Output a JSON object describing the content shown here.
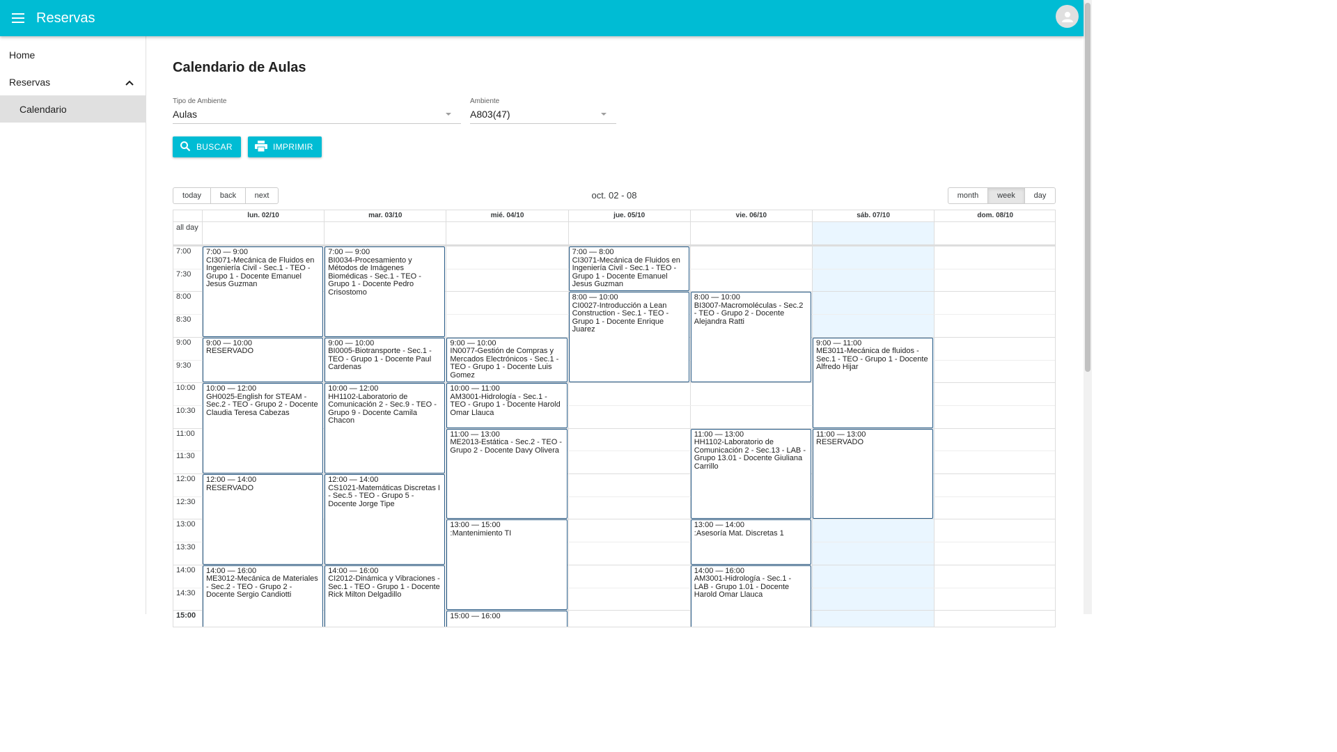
{
  "appbar": {
    "title": "Reservas",
    "menu_icon": "menu-icon",
    "avatar_icon": "account-circle-icon"
  },
  "sidebar": {
    "items": [
      {
        "label": "Home"
      },
      {
        "label": "Reservas"
      },
      {
        "label": "Calendario"
      }
    ]
  },
  "page": {
    "title": "Calendario de Aulas"
  },
  "filters": {
    "tipo_label": "Tipo de Ambiente",
    "tipo_value": "Aulas",
    "ambiente_label": "Ambiente",
    "ambiente_value": "A803(47)"
  },
  "actions": {
    "buscar": "BUSCAR",
    "imprimir": "IMPRIMIR"
  },
  "calendar": {
    "nav": {
      "today": "today",
      "back": "back",
      "next": "next"
    },
    "range_label": "oct. 02 - 08",
    "views": {
      "month": "month",
      "week": "week",
      "day": "day"
    },
    "active_view": "week",
    "allday_label": "all day",
    "days": [
      "lun. 02/10",
      "mar. 03/10",
      "mié. 04/10",
      "jue. 05/10",
      "vie. 06/10",
      "sáb. 07/10",
      "dom. 08/10"
    ],
    "highlight_day_index": 5,
    "times": [
      "7:00",
      "7:30",
      "8:00",
      "8:30",
      "9:00",
      "9:30",
      "10:00",
      "10:30",
      "11:00",
      "11:30",
      "12:00",
      "12:30",
      "13:00",
      "13:30",
      "14:00",
      "14:30",
      "15:00"
    ],
    "events": [
      {
        "day": 0,
        "start": 7,
        "end": 9,
        "time": "7:00 — 9:00",
        "title": "CI3071-Mecánica de Fluidos en Ingeniería Civil - Sec.1 - TEO - Grupo 1 - Docente Emanuel Jesus Guzman"
      },
      {
        "day": 0,
        "start": 9,
        "end": 10,
        "time": "9:00 — 10:00",
        "title": "RESERVADO"
      },
      {
        "day": 0,
        "start": 10,
        "end": 12,
        "time": "10:00 — 12:00",
        "title": "GH0025-English for STEAM - Sec.2 - TEO - Grupo 2 - Docente Claudia Teresa Cabezas"
      },
      {
        "day": 0,
        "start": 12,
        "end": 14,
        "time": "12:00 — 14:00",
        "title": "RESERVADO"
      },
      {
        "day": 0,
        "start": 14,
        "end": 16,
        "time": "14:00 — 16:00",
        "title": "ME3012-Mecánica de Materiales - Sec.2 - TEO - Grupo 2 - Docente Sergio Candiotti"
      },
      {
        "day": 1,
        "start": 7,
        "end": 9,
        "time": "7:00 — 9:00",
        "title": "BI0034-Procesamiento y Métodos de Imágenes Biomédicas - Sec.1 - TEO - Grupo 1 - Docente Pedro Crisostomo"
      },
      {
        "day": 1,
        "start": 9,
        "end": 10,
        "time": "9:00 — 10:00",
        "title": "BI0005-Biotransporte - Sec.1 - TEO - Grupo 1 - Docente Paul Cardenas"
      },
      {
        "day": 1,
        "start": 10,
        "end": 12,
        "time": "10:00 — 12:00",
        "title": "HH1102-Laboratorio de Comunicación 2 - Sec.9 - TEO - Grupo 9 - Docente Camila Chacon"
      },
      {
        "day": 1,
        "start": 12,
        "end": 14,
        "time": "12:00 — 14:00",
        "title": "CS1021-Matemáticas Discretas I - Sec.5 - TEO - Grupo 5 - Docente Jorge Tipe"
      },
      {
        "day": 1,
        "start": 14,
        "end": 16,
        "time": "14:00 — 16:00",
        "title": "CI2012-Dinámica y Vibraciones - Sec.1 - TEO - Grupo 1 - Docente Rick Milton Delgadillo"
      },
      {
        "day": 2,
        "start": 9,
        "end": 10,
        "time": "9:00 — 10:00",
        "title": "IN0077-Gestión de Compras y Mercados Electrónicos - Sec.1 - TEO - Grupo 1 - Docente Luis Gomez"
      },
      {
        "day": 2,
        "start": 10,
        "end": 11,
        "time": "10:00 — 11:00",
        "title": "AM3001-Hidrología - Sec.1 - TEO - Grupo 1 - Docente Harold Omar Llauca"
      },
      {
        "day": 2,
        "start": 11,
        "end": 13,
        "time": "11:00 — 13:00",
        "title": "ME2013-Estática - Sec.2 - TEO - Grupo 2 - Docente Davy Olivera"
      },
      {
        "day": 2,
        "start": 13,
        "end": 15,
        "time": "13:00 — 15:00",
        "title": ":Mantenimiento TI"
      },
      {
        "day": 2,
        "start": 15,
        "end": 16,
        "time": "15:00 — 16:00",
        "title": ""
      },
      {
        "day": 3,
        "start": 7,
        "end": 8,
        "time": "7:00 — 8:00",
        "title": "CI3071-Mecánica de Fluidos en Ingeniería Civil - Sec.1 - TEO - Grupo 1 - Docente Emanuel Jesus Guzman"
      },
      {
        "day": 3,
        "start": 8,
        "end": 10,
        "time": "8:00 — 10:00",
        "title": "CI0027-Introducción a Lean Construction - Sec.1 - TEO - Grupo 1 - Docente Enrique Juarez"
      },
      {
        "day": 4,
        "start": 8,
        "end": 10,
        "time": "8:00 — 10:00",
        "title": "BI3007-Macromoléculas - Sec.2 - TEO - Grupo 2 - Docente Alejandra Ratti"
      },
      {
        "day": 4,
        "start": 11,
        "end": 13,
        "time": "11:00 — 13:00",
        "title": "HH1102-Laboratorio de Comunicación 2 - Sec.13 - LAB - Grupo 13.01 - Docente Giuliana Carrillo"
      },
      {
        "day": 4,
        "start": 13,
        "end": 14,
        "time": "13:00 — 14:00",
        "title": ":Asesoría Mat. Discretas 1"
      },
      {
        "day": 4,
        "start": 14,
        "end": 16,
        "time": "14:00 — 16:00",
        "title": "AM3001-Hidrología - Sec.1 - LAB - Grupo 1.01 - Docente Harold Omar Llauca"
      },
      {
        "day": 5,
        "start": 9,
        "end": 11,
        "time": "9:00 — 11:00",
        "title": "ME3011-Mecánica de fluidos - Sec.1 - TEO - Grupo 1 - Docente Alfredo Hijar"
      },
      {
        "day": 5,
        "start": 11,
        "end": 13,
        "time": "11:00 — 13:00",
        "title": "RESERVADO"
      }
    ]
  },
  "colors": {
    "primary": "#00bcd4",
    "event_border": "#265985",
    "today_bg": "#eaf6ff"
  }
}
